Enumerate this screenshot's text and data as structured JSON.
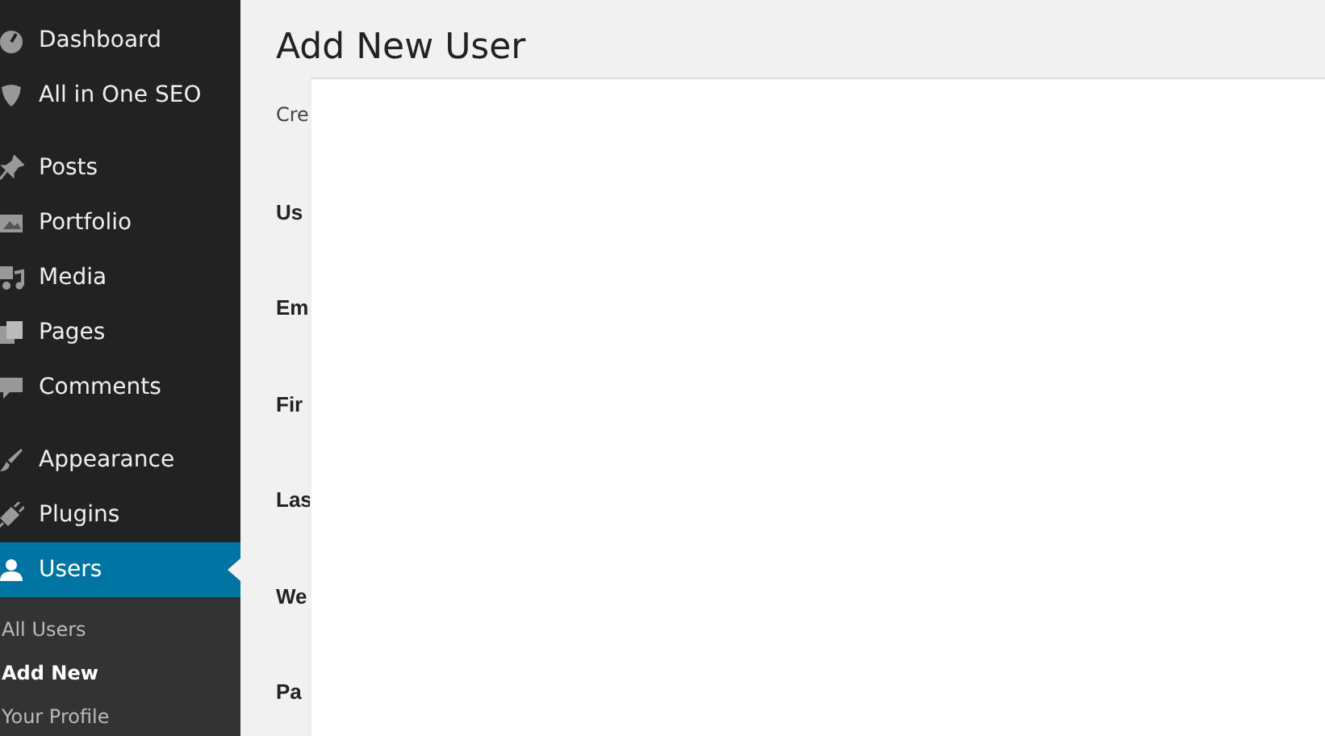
{
  "sidebar": {
    "groups": [
      {
        "items": [
          {
            "label": "Dashboard",
            "kind": "dashboard",
            "selected": false
          },
          {
            "label": "All in One SEO",
            "kind": "shield",
            "selected": false
          }
        ]
      },
      {
        "items": [
          {
            "label": "Posts",
            "kind": "pin",
            "selected": false
          },
          {
            "label": "Portfolio",
            "kind": "image",
            "selected": false
          },
          {
            "label": "Media",
            "kind": "media",
            "selected": false
          },
          {
            "label": "Pages",
            "kind": "pages",
            "selected": false
          },
          {
            "label": "Comments",
            "kind": "comment",
            "selected": false
          }
        ]
      },
      {
        "items": [
          {
            "label": "Appearance",
            "kind": "brush",
            "selected": false
          },
          {
            "label": "Plugins",
            "kind": "plug",
            "selected": false
          },
          {
            "label": "Users",
            "kind": "user",
            "selected": true
          }
        ]
      }
    ],
    "submenu": [
      {
        "label": "All Users",
        "selected": false
      },
      {
        "label": "Add New",
        "selected": true
      },
      {
        "label": "Your Profile",
        "selected": false
      }
    ]
  },
  "page": {
    "title": "Add New User",
    "intro": "Cre",
    "fields": [
      "Us",
      "Em",
      "Fir",
      "Las",
      "We",
      "Pa"
    ]
  }
}
